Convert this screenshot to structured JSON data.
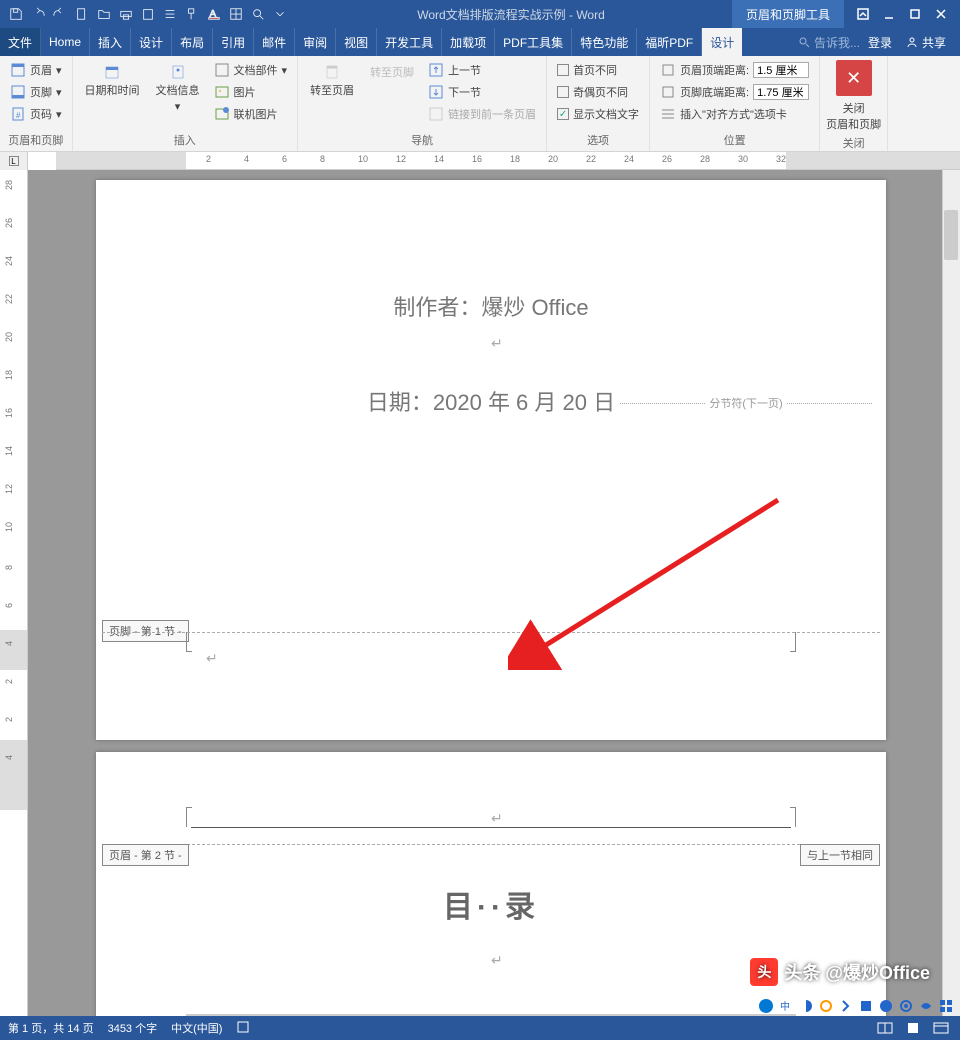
{
  "title": "Word文档排版流程实战示例 - Word",
  "context_tab": "页眉和页脚工具",
  "tabs": [
    "文件",
    "Home",
    "插入",
    "设计",
    "布局",
    "引用",
    "邮件",
    "审阅",
    "视图",
    "开发工具",
    "加载项",
    "PDF工具集",
    "特色功能",
    "福昕PDF",
    "设计"
  ],
  "active_tab_index": 14,
  "tell_me": "告诉我...",
  "login": "登录",
  "share": "共享",
  "ribbon": {
    "g1": {
      "header": "页眉",
      "footer": "页脚",
      "page_num": "页码",
      "label": "页眉和页脚"
    },
    "g2": {
      "datetime": "日期和时间",
      "docinfo": "文档信息",
      "parts": "文档部件",
      "picture": "图片",
      "online_pic": "联机图片",
      "label": "插入"
    },
    "g3": {
      "to_header": "转至页眉",
      "to_footer": "转至页脚",
      "prev": "上一节",
      "next": "下一节",
      "link_prev": "链接到前一条页眉",
      "label": "导航"
    },
    "g4": {
      "first_diff": "首页不同",
      "odd_even": "奇偶页不同",
      "show_text": "显示文档文字",
      "label": "选项"
    },
    "g5": {
      "top_dist": "页眉顶端距离:",
      "bot_dist": "页脚底端距离:",
      "top_val": "1.5 厘米",
      "bot_val": "1.75 厘米",
      "insert_align": "插入\"对齐方式\"选项卡",
      "label": "位置"
    },
    "g6": {
      "close": "关闭",
      "close_hf": "页眉和页脚",
      "label": "关闭"
    }
  },
  "document": {
    "author_line": "制作者：爆炒 Office",
    "date_line": "日期：2020 年 6 月 20 日",
    "section_break": "分节符(下一页)",
    "footer_sec1": "页脚 - 第 1 节 -",
    "header_sec2": "页眉 - 第 2 节 -",
    "same_as_prev": "与上一节相同",
    "toc": "目··录"
  },
  "status": {
    "page": "第 1 页，共 14 页",
    "words": "3453 个字",
    "lang": "中文(中国)"
  },
  "watermark": "头条 @爆炒Office",
  "ruler_marks": [
    2,
    4,
    6,
    8,
    10,
    12,
    14,
    16,
    18,
    20,
    22,
    24,
    26,
    28,
    30,
    32
  ],
  "vruler_marks": [
    28,
    26,
    24,
    22,
    20,
    18,
    16,
    14,
    12,
    10,
    8,
    6,
    4,
    2,
    2,
    4
  ]
}
